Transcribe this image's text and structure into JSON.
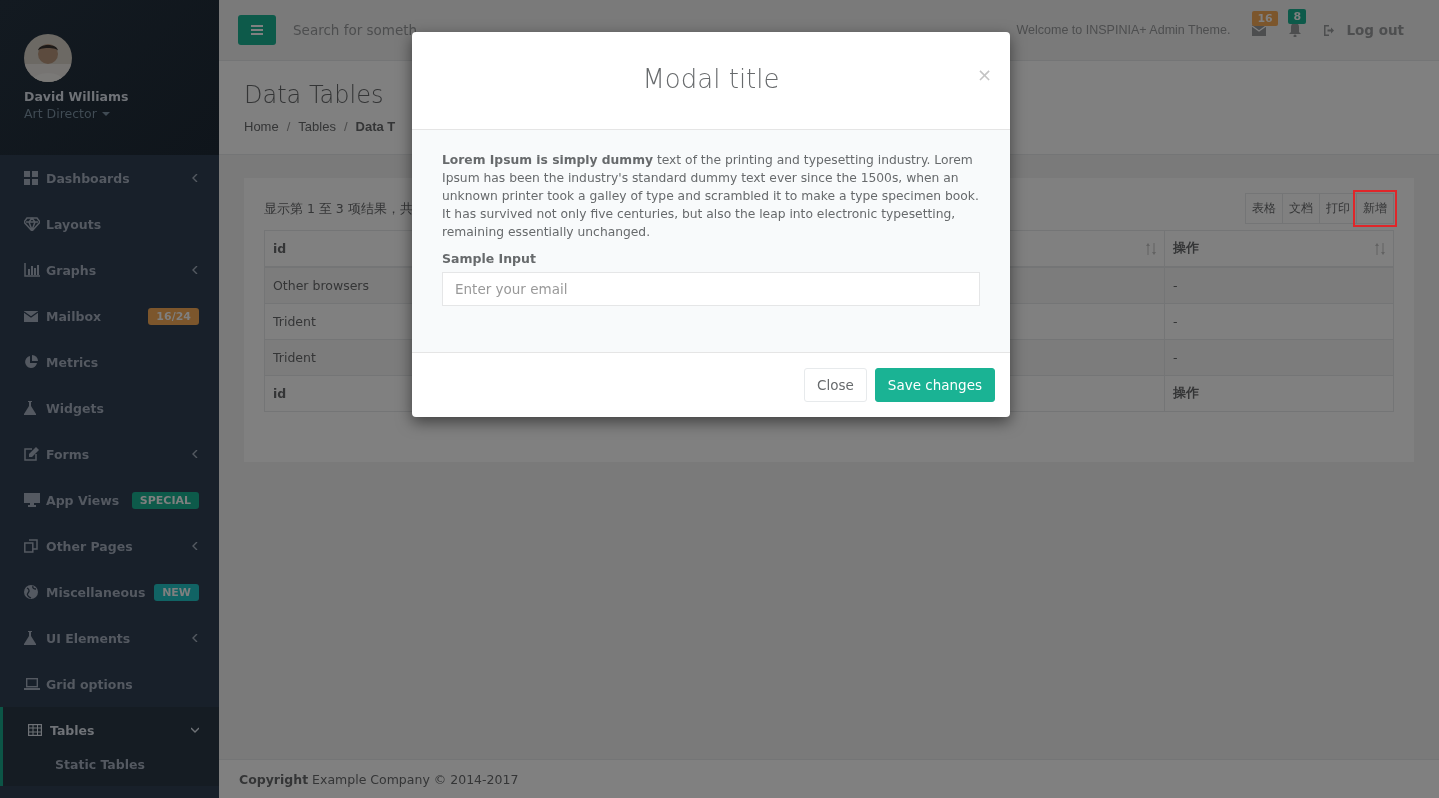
{
  "sidebar": {
    "profile": {
      "name": "David Williams",
      "role": "Art Director"
    },
    "items": [
      {
        "label": "Dashboards",
        "kind": "arrow",
        "selected": false,
        "expanded": false
      },
      {
        "label": "Layouts",
        "kind": "plain",
        "selected": false
      },
      {
        "label": "Graphs",
        "kind": "arrow",
        "selected": false,
        "expanded": false
      },
      {
        "label": "Mailbox",
        "kind": "badge",
        "selected": false,
        "badge": "16/24",
        "color": "#7c562c"
      },
      {
        "label": "Metrics",
        "kind": "plain",
        "selected": false
      },
      {
        "label": "Widgets",
        "kind": "plain",
        "selected": false
      },
      {
        "label": "Forms",
        "kind": "arrow",
        "selected": false,
        "expanded": false
      },
      {
        "label": "App Views",
        "kind": "badge",
        "selected": false,
        "badge": "SPECIAL",
        "color": "#0d5a4a"
      },
      {
        "label": "Other Pages",
        "kind": "arrow",
        "selected": false,
        "expanded": false
      },
      {
        "label": "Miscellaneous",
        "kind": "badge",
        "selected": false,
        "badge": "NEW",
        "color": "#116364"
      },
      {
        "label": "UI Elements",
        "kind": "arrow",
        "selected": false,
        "expanded": false
      },
      {
        "label": "Grid options",
        "kind": "plain",
        "selected": false
      },
      {
        "label": "Tables",
        "kind": "arrow",
        "selected": true,
        "expanded": true,
        "children": [
          {
            "label": "Static Tables",
            "selected": false
          }
        ]
      }
    ]
  },
  "topbar": {
    "search": {
      "placeholder": "Search for someth"
    },
    "welcome": "Welcome to INSPINIA+ Admin Theme.",
    "notifications": [
      {
        "count": "16",
        "color": "#7c562c"
      },
      {
        "count": "8",
        "color": "#0d5a4a"
      }
    ],
    "logout": "Log out"
  },
  "page_heading": {
    "title": "Data Tables",
    "separator": "/",
    "breadcrumb": [
      {
        "label": "Home",
        "active": false
      },
      {
        "label": "Tables",
        "active": false
      },
      {
        "label": "Data T",
        "active": true
      }
    ]
  },
  "table": {
    "info": "显示第 1 至 3 项结果，共",
    "buttons": [
      {
        "label": "表格",
        "marked": false
      },
      {
        "label": "文档",
        "marked": false
      },
      {
        "label": "打印",
        "marked": false
      },
      {
        "label": "新增",
        "marked": true
      }
    ],
    "columns": [
      {
        "label": "id",
        "sortable": false
      },
      {
        "sortable": true
      },
      {
        "label": "操作",
        "sortable": true
      }
    ],
    "rows": [
      {
        "id": "Other browsers",
        "column_3": "-"
      },
      {
        "id": "Trident",
        "column_3": "-"
      },
      {
        "id": "Trident",
        "column_3": "-"
      }
    ],
    "footer": [
      "id",
      "操作"
    ]
  },
  "modal": {
    "title": "Modal title",
    "close": "×",
    "text": "**Lorem Ipsum is simply dummy** text of the printing and typesetting industry. Lorem Ipsum has been the industry's standard dummy text ever since the 1500s, when an unknown printer took a galley of type and scrambled it to make a type specimen book. It has survived not only five centuries, but also the leap into electronic typesetting, remaining essentially unchanged.",
    "field": {
      "label": "Sample Input",
      "placeholder": "Enter your email"
    },
    "buttons": [
      {
        "label": "Close",
        "kind": "default"
      },
      {
        "label": "Save changes",
        "kind": "primary"
      }
    ]
  },
  "footer": {
    "text": "**Copyright** Example Company © 2014-2017"
  }
}
